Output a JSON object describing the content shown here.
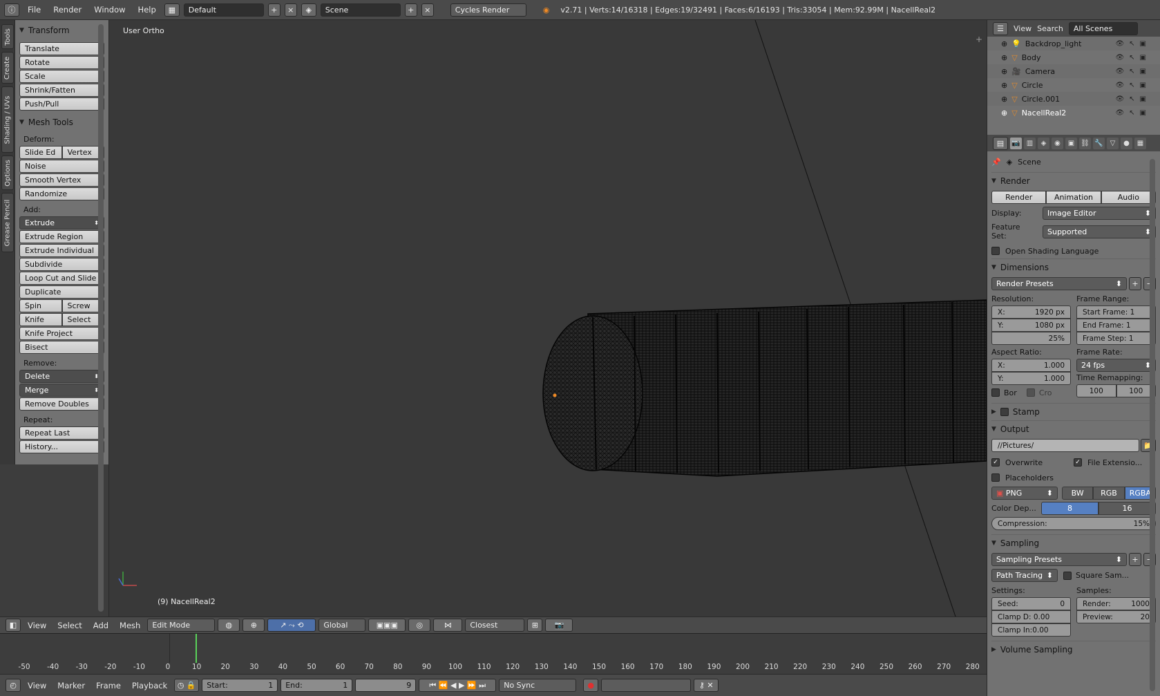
{
  "topbar": {
    "menus": [
      "File",
      "Render",
      "Window",
      "Help"
    ],
    "layout": "Default",
    "scene": "Scene",
    "engine": "Cycles Render",
    "stats": "v2.71 | Verts:14/16318 | Edges:19/32491 | Faces:6/16193 | Tris:33054 | Mem:92.99M | NacellReal2"
  },
  "vtabs": [
    "Tools",
    "Create",
    "Shading / UVs",
    "Options",
    "Grease Pencil"
  ],
  "tools": {
    "transform_title": "Transform",
    "transform": [
      "Translate",
      "Rotate",
      "Scale",
      "Shrink/Fatten",
      "Push/Pull"
    ],
    "mesh_title": "Mesh Tools",
    "deform_label": "Deform:",
    "slide_edge": "Slide Ed",
    "vertex": "Vertex",
    "deform": [
      "Noise",
      "Smooth Vertex",
      "Randomize"
    ],
    "add_label": "Add:",
    "extrude": "Extrude",
    "add": [
      "Extrude Region",
      "Extrude Individual",
      "Subdivide",
      "Loop Cut and Slide",
      "Duplicate"
    ],
    "spin": "Spin",
    "screw": "Screw",
    "knife": "Knife",
    "select": "Select",
    "add2": [
      "Knife Project",
      "Bisect"
    ],
    "remove_label": "Remove:",
    "delete": "Delete",
    "merge": "Merge",
    "remove_doubles": "Remove Doubles",
    "repeat_label": "Repeat:",
    "repeat_last": "Repeat Last",
    "history": "History..."
  },
  "viewport": {
    "title": "User Ortho",
    "object": "(9) NacellReal2"
  },
  "hdr3d": {
    "menus": [
      "View",
      "Select",
      "Add",
      "Mesh"
    ],
    "mode": "Edit Mode",
    "orientation": "Global",
    "snap": "Closest"
  },
  "timeline": {
    "ticks": [
      "-50",
      "-40",
      "-30",
      "-20",
      "-10",
      "0",
      "10",
      "20",
      "30",
      "40",
      "50",
      "60",
      "70",
      "80",
      "90",
      "100",
      "110",
      "120",
      "130",
      "140",
      "150",
      "160",
      "170",
      "180",
      "190",
      "200",
      "210",
      "220",
      "230",
      "240",
      "250",
      "260",
      "270",
      "280"
    ],
    "current_frame": 9
  },
  "hdrtl": {
    "menus": [
      "View",
      "Marker",
      "Frame",
      "Playback"
    ],
    "start_label": "Start:",
    "start": "1",
    "end_label": "End:",
    "end": "1",
    "frame": "9",
    "sync": "No Sync"
  },
  "outliner": {
    "menus": [
      "View",
      "Search",
      "All Scenes"
    ],
    "objects": [
      "Backdrop_light",
      "Body",
      "Camera",
      "Circle",
      "Circle.001",
      "NacellReal2"
    ]
  },
  "props": {
    "scene": "Scene",
    "render_title": "Render",
    "render_btn": "Render",
    "animation_btn": "Animation",
    "audio_btn": "Audio",
    "display_label": "Display:",
    "display": "Image Editor",
    "feature_label": "Feature Set:",
    "feature": "Supported",
    "osl": "Open Shading Language",
    "dimensions_title": "Dimensions",
    "render_presets": "Render Presets",
    "resolution_label": "Resolution:",
    "res_x": "1920 px",
    "res_y": "1080 px",
    "res_pct": "25%",
    "frame_range_label": "Frame Range:",
    "start_frame": "Start Frame: 1",
    "end_frame": "End Frame: 1",
    "frame_step": "Frame Step: 1",
    "aspect_label": "Aspect Ratio:",
    "asp_x": "1.000",
    "asp_y": "1.000",
    "frame_rate_label": "Frame Rate:",
    "fps": "24 fps",
    "time_remap_label": "Time Remapping:",
    "remap_old": "100",
    "remap_new": "100",
    "border": "Bor",
    "crop": "Cro",
    "stamp_title": "Stamp",
    "output_title": "Output",
    "output_path": "//Pictures/",
    "overwrite": "Overwrite",
    "file_ext": "File Extensio...",
    "placeholders": "Placeholders",
    "format": "PNG",
    "bw": "BW",
    "rgb": "RGB",
    "rgba": "RGBA",
    "color_depth_label": "Color Dep...",
    "depth8": "8",
    "depth16": "16",
    "compression": "Compression:",
    "compression_val": "15%",
    "sampling_title": "Sampling",
    "sampling_presets": "Sampling Presets",
    "path_tracing": "Path Tracing",
    "square_samples": "Square Sam...",
    "settings_label": "Settings:",
    "samples_label": "Samples:",
    "seed": "Seed:",
    "seed_val": "0",
    "render_samples": "Render:",
    "render_samples_val": "1000",
    "clamp_d": "Clamp D: 0.00",
    "preview": "Preview:",
    "preview_val": "20",
    "clamp_i": "Clamp In:0.00",
    "volume_title": "Volume Sampling"
  }
}
